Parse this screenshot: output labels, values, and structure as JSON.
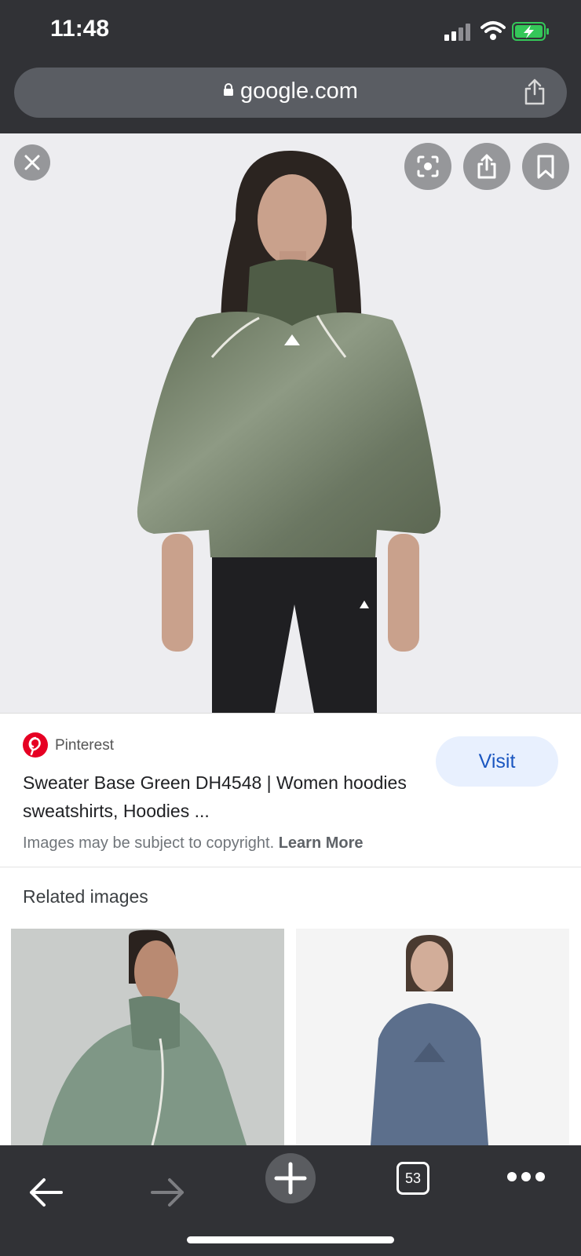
{
  "status": {
    "time": "11:48"
  },
  "browser": {
    "url": "google.com",
    "tab_count": "53"
  },
  "result": {
    "source": "Pinterest",
    "title": "Sweater Base Green DH4548 | Women hoodies sweatshirts, Hoodies ...",
    "visit_label": "Visit",
    "copyright_text": "Images may be subject to copyright.",
    "learn_more": "Learn More"
  },
  "related": {
    "heading": "Related images"
  },
  "icons": {
    "close": "close-icon",
    "lens": "lens-icon",
    "share": "share-icon",
    "bookmark": "bookmark-icon",
    "back": "back-arrow-icon",
    "forward": "forward-arrow-icon",
    "new_tab": "plus-icon",
    "tabs": "tabs-icon",
    "more": "more-icon"
  },
  "colors": {
    "chrome_dark": "#313236",
    "url_bar": "#5a5d63",
    "visit_bg": "#e8f0fe",
    "visit_text": "#1a56c0",
    "pinterest": "#e60023",
    "battery_green": "#34c759"
  }
}
